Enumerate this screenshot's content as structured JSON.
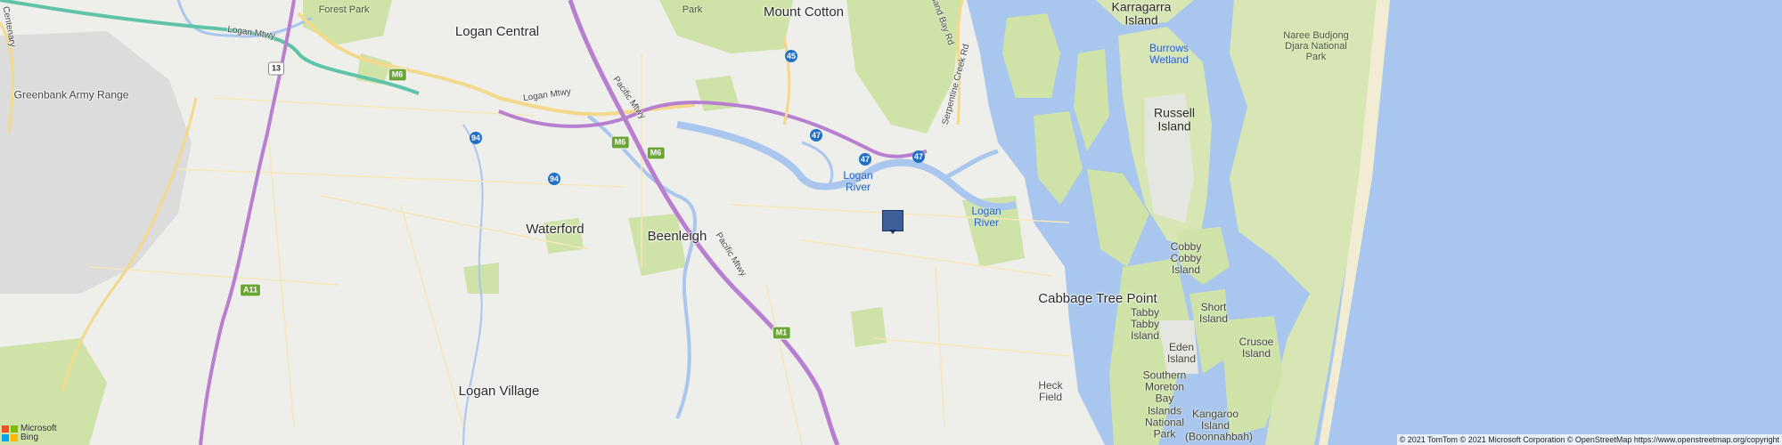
{
  "colors": {
    "water": "#a9c6ee",
    "land": "#eeeeea",
    "greenery": "#cfe3a9",
    "motorway": "#b87fd1",
    "highway": "#f3d98b",
    "marker": "#3e5f9a"
  },
  "labels": {
    "logan_central": "Logan Central",
    "mount_cotton": "Mount Cotton",
    "karragarra": "Karragarra\nIsland",
    "naree": "Naree Budjong\nDjara National\nPark",
    "burrows": "Burrows\nWetland",
    "russell": "Russell\nIsland",
    "forest_park": "Forest Park",
    "park_top": "Park",
    "greenbank": "Greenbank Army Range",
    "logan_mtwy1": "Logan Mtwy",
    "logan_mtwy2": "Logan Mtwy",
    "pacific_mtwy1": "Pacific Mtwy",
    "pacific_mtwy2": "Pacific Mtwy",
    "serpentine": "Serpentine Creek Rd",
    "redland_bay": "dland Bay Rd",
    "centenary": "Centenary",
    "logan_river1": "Logan\nRiver",
    "logan_river2": "Logan\nRiver",
    "waterford": "Waterford",
    "beenleigh": "Beenleigh",
    "cabbage_tree": "Cabbage Tree Point",
    "cobby": "Cobby\nCobby\nIsland",
    "tabby": "Tabby\nTabby\nIsland",
    "short": "Short\nIsland",
    "eden": "Eden\nIsland",
    "crusoe": "Crusoe\nIsland",
    "southern_moreton": "Southern\nMoreton\nBay\nIslands\nNational\nPark",
    "kangaroo": "Kangaroo\nIsland",
    "boonnahbah": "(Boonnahbah)",
    "heck_field": "Heck\nField",
    "logan_village": "Logan Village"
  },
  "shields": {
    "m13": "13",
    "m6a": "M6",
    "m94a": "94",
    "m94b": "94",
    "m6b": "M6",
    "m6c": "M6",
    "m45": "45",
    "m47a": "47",
    "m47b": "47",
    "m47c": "47",
    "a11": "A11",
    "m1": "M1"
  },
  "attribution": {
    "bing_line1": "Microsoft",
    "bing_line2": "Bing",
    "copyright": "© 2021 TomTom © 2021 Microsoft Corporation © OpenStreetMap https://www.openstreetmap.org/copyright"
  }
}
